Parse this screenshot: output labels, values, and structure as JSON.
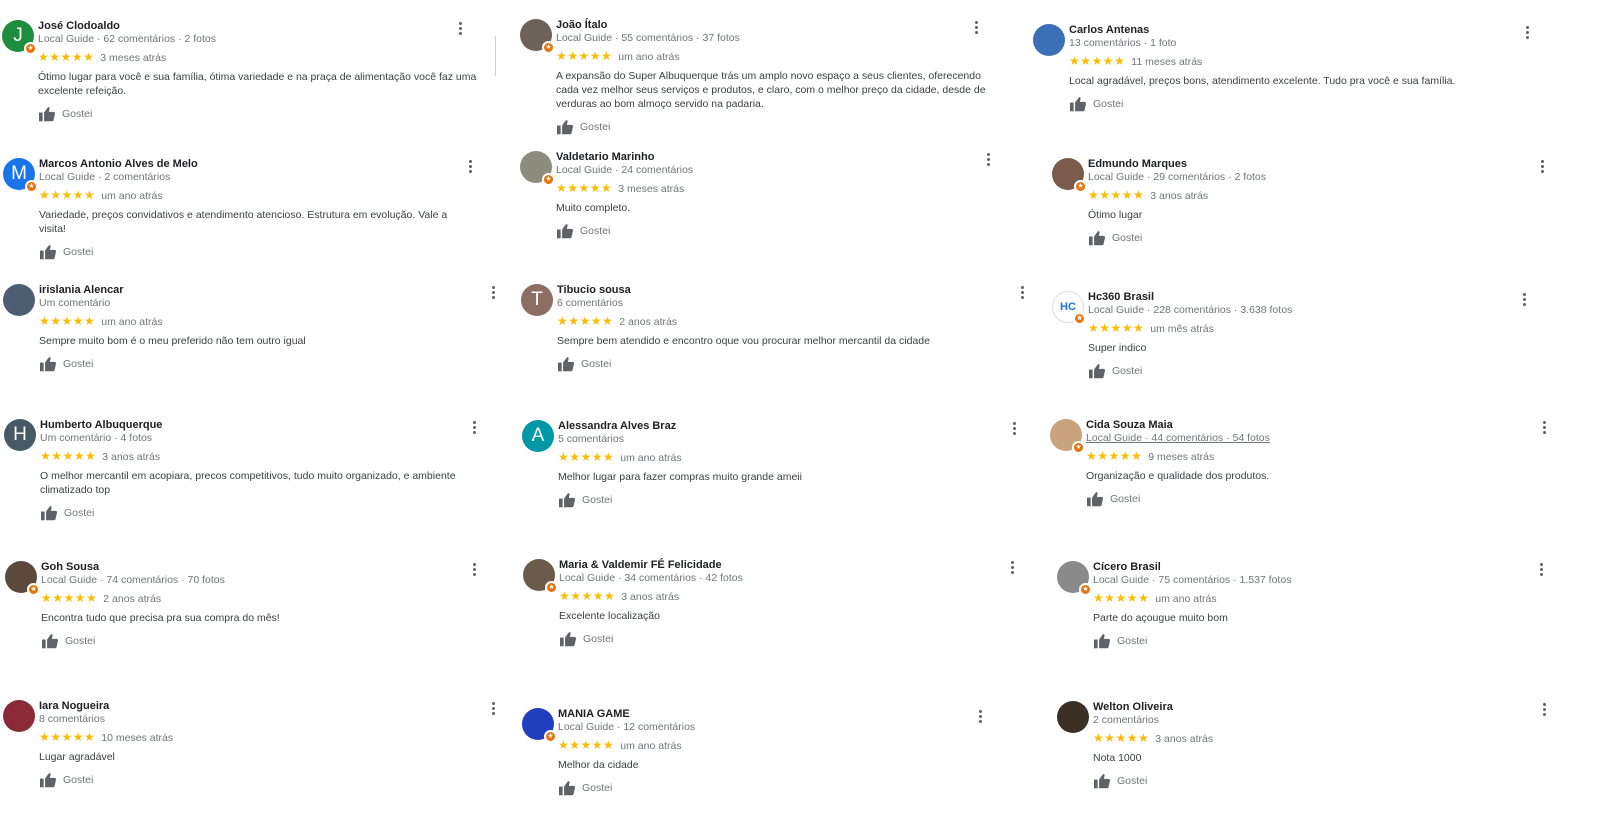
{
  "ui": {
    "like_label": "Gostei",
    "guide_label": "Local Guide"
  },
  "reviews": [
    {
      "name": "José Clodoaldo",
      "meta": "Local Guide · 62 comentários · 2 fotos",
      "stars": "★★★★★",
      "when": "3 meses atrás",
      "text": "Ótimo lugar para você e sua família, ótima variedade e na praça de alimentação você faz uma excelente refeição.",
      "avatar_letter": "J",
      "avatar_color": "#1e8e3e"
    },
    {
      "name": "João Ítalo",
      "meta": "Local Guide · 55 comentários · 37 fotos",
      "stars": "★★★★★",
      "when": "um ano atrás",
      "text": "A expansão do Super Albuquerque trás um amplo novo espaço a seus clientes, oferecendo cada vez melhor seus serviços e produtos, e claro, com o melhor preço da cidade, desde de verduras ao bom almoço servido na padaria.",
      "avatar_letter": "",
      "avatar_color": "#6d6259"
    },
    {
      "name": "Carlos Antenas",
      "meta": "13 comentários · 1 foto",
      "stars": "★★★★★",
      "when": "11 meses atrás",
      "text": "Local agradável, preços bons, atendimento excelente. Tudo  pra você e sua família.",
      "avatar_letter": "",
      "avatar_color": "#3b6fb6"
    },
    {
      "name": "Marcos Antonio Alves de Melo",
      "meta": "Local Guide · 2 comentários",
      "stars": "★★★★★",
      "when": "um ano atrás",
      "text": "Variedade, preços convidativos e atendimento atencioso. Estrutura em evolução. Vale a visita!",
      "avatar_letter": "M",
      "avatar_color": "#1a73e8"
    },
    {
      "name": "Valdetario Marinho",
      "meta": "Local Guide · 24 comentários",
      "stars": "★★★★★",
      "when": "3 meses atrás",
      "text": "Muito completo.",
      "avatar_letter": "",
      "avatar_color": "#8d8a7e"
    },
    {
      "name": "Edmundo Marques",
      "meta": "Local Guide · 29 comentários · 2 fotos",
      "stars": "★★★★★",
      "when": "3 anos atrás",
      "text": "Ótimo lugar",
      "avatar_letter": "",
      "avatar_color": "#7a5a4a"
    },
    {
      "name": "irislania Alencar",
      "meta": "Um comentário",
      "stars": "★★★★★",
      "when": "um ano atrás",
      "text": "Sempre muito bom é o meu preferido não tem outro igual",
      "avatar_letter": "",
      "avatar_color": "#4f5d73"
    },
    {
      "name": "Tibucio sousa",
      "meta": "6 comentários",
      "stars": "★★★★★",
      "when": "2 anos atrás",
      "text": "Sempre bem atendido e encontro oque vou procurar melhor mercantil da cidade",
      "avatar_letter": "T",
      "avatar_color": "#8d6e63"
    },
    {
      "name": "Hc360 Brasil",
      "meta": "Local Guide · 228 comentários · 3.638 fotos",
      "stars": "★★★★★",
      "when": "um mês atrás",
      "text": "Super indico",
      "avatar_letter": "HC",
      "avatar_color": "#ffffff"
    },
    {
      "name": "Humberto Albuquerque",
      "meta": "Um comentário · 4 fotos",
      "stars": "★★★★★",
      "when": "3 anos atrás",
      "text": "O melhor mercantil em acopiara, precos competitivos, tudo muito organizado, e ambiente climatizado top",
      "avatar_letter": "H",
      "avatar_color": "#455a64"
    },
    {
      "name": "Alessandra Alves Braz",
      "meta": "5 comentários",
      "stars": "★★★★★",
      "when": "um ano atrás",
      "text": "Melhor lugar para fazer compras muito grande ameii",
      "avatar_letter": "A",
      "avatar_color": "#0097a7"
    },
    {
      "name": "Cida Souza Maia",
      "meta": "Local Guide · 44 comentários · 54 fotos",
      "stars": "★★★★★",
      "when": "9 meses atrás",
      "text": "Organização e qualidade dos produtos.",
      "avatar_letter": "",
      "avatar_color": "#c9a27e"
    },
    {
      "name": "Goh Sousa",
      "meta": "Local Guide · 74 comentários · 70 fotos",
      "stars": "★★★★★",
      "when": "2 anos atrás",
      "text": "Encontra tudo que precisa pra sua compra do mês!",
      "avatar_letter": "",
      "avatar_color": "#5b4a3c"
    },
    {
      "name": "Maria & Valdemir FÉ Felicidade",
      "meta": "Local Guide · 34 comentários · 42 fotos",
      "stars": "★★★★★",
      "when": "3 anos atrás",
      "text": "Excelente localização",
      "avatar_letter": "",
      "avatar_color": "#6b5b4a"
    },
    {
      "name": "Cícero Brasil",
      "meta": "Local Guide · 75 comentários · 1.537 fotos",
      "stars": "★★★★★",
      "when": "um ano atrás",
      "text": "Parte do açougue muito bom",
      "avatar_letter": "",
      "avatar_color": "#8a8a8a"
    },
    {
      "name": "Iara Nogueira",
      "meta": "8 comentários",
      "stars": "★★★★★",
      "when": "10 meses atrás",
      "text": "Lugar agradável",
      "avatar_letter": "",
      "avatar_color": "#8b2b3a"
    },
    {
      "name": "MANIA GAME",
      "meta": "Local Guide · 12 comentários",
      "stars": "★★★★★",
      "when": "um ano atrás",
      "text": "Melhor da cidade",
      "avatar_letter": "",
      "avatar_color": "#1f3fbf"
    },
    {
      "name": "Welton Oliveira",
      "meta": "2 comentários",
      "stars": "★★★★★",
      "when": "3 anos atrás",
      "text": "Nota 1000",
      "avatar_letter": "",
      "avatar_color": "#3a3026"
    }
  ]
}
